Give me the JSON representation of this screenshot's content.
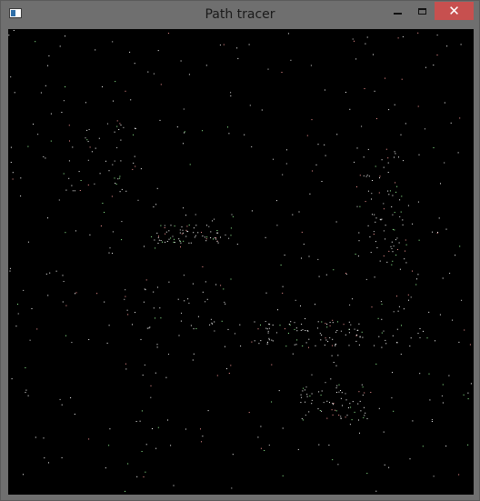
{
  "window": {
    "title": "Path tracer",
    "controls": {
      "minimize_icon": "minimize-icon",
      "maximize_icon": "maximize-icon",
      "close_glyph": "✕"
    },
    "accent_close": "#c7504f",
    "frame_color": "#6f6f6f"
  },
  "render": {
    "background": "#000000",
    "pixel_color": "#ffffff"
  }
}
